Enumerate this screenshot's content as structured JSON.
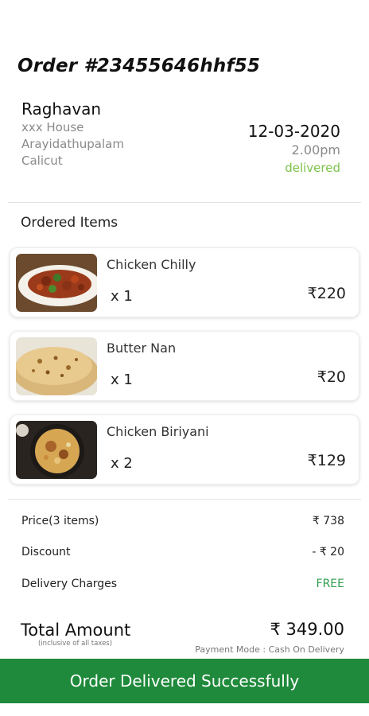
{
  "order": {
    "title": "Order #23455646hhf55"
  },
  "customer": {
    "name": "Raghavan",
    "address_lines": [
      "xxx House",
      "Arayidathupalam",
      "Calicut"
    ]
  },
  "meta": {
    "date": "12-03-2020",
    "time": "2.00pm",
    "status": "delivered",
    "status_color": "#7cc24a"
  },
  "section": {
    "ordered_items": "Ordered Items"
  },
  "items": [
    {
      "name": "Chicken Chilly",
      "qty": "x 1",
      "price": "₹220",
      "image": "chicken-chilly-image"
    },
    {
      "name": "Butter Nan",
      "qty": "x 1",
      "price": "₹20",
      "image": "butter-nan-image"
    },
    {
      "name": "Chicken Biriyani",
      "qty": "x 2",
      "price": "₹129",
      "image": "chicken-biriyani-image"
    }
  ],
  "summary": {
    "price_label": "Price(3 items)",
    "price_value": "₹ 738",
    "discount_label": "Discount",
    "discount_value": "- ₹ 20",
    "delivery_label": "Delivery Charges",
    "delivery_value": "FREE",
    "free_color": "#2e9e4d"
  },
  "total": {
    "label": "Total Amount",
    "note": "(inclusive of all taxes)",
    "value": "₹ 349.00",
    "payment_mode": "Payment Mode : Cash On Delivery"
  },
  "footer": {
    "message": "Order Delivered Successfully",
    "bar_color": "#1f8a3b"
  }
}
